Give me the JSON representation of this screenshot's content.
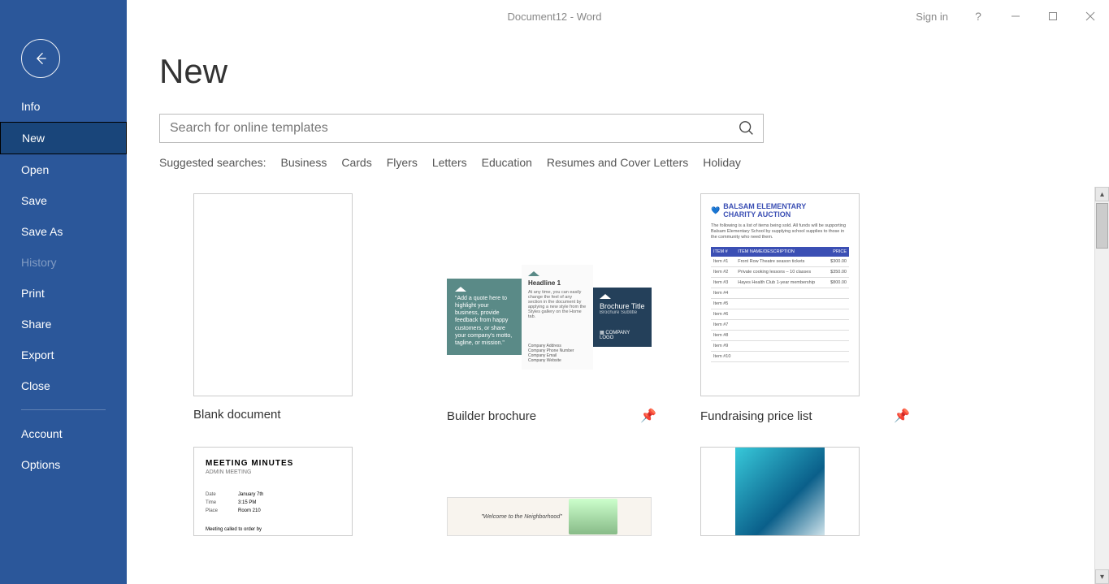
{
  "titlebar": {
    "title": "Document12  -  Word",
    "signin": "Sign in",
    "help": "?"
  },
  "sidebar": {
    "items": [
      {
        "label": "Info",
        "name": "info"
      },
      {
        "label": "New",
        "name": "new",
        "active": true
      },
      {
        "label": "Open",
        "name": "open"
      },
      {
        "label": "Save",
        "name": "save"
      },
      {
        "label": "Save As",
        "name": "save-as"
      },
      {
        "label": "History",
        "name": "history",
        "disabled": true
      },
      {
        "label": "Print",
        "name": "print"
      },
      {
        "label": "Share",
        "name": "share"
      },
      {
        "label": "Export",
        "name": "export"
      },
      {
        "label": "Close",
        "name": "close"
      }
    ],
    "footer": [
      {
        "label": "Account",
        "name": "account"
      },
      {
        "label": "Options",
        "name": "options"
      }
    ]
  },
  "page": {
    "title": "New",
    "search_placeholder": "Search for online templates",
    "suggested_label": "Suggested searches:",
    "suggested": [
      "Business",
      "Cards",
      "Flyers",
      "Letters",
      "Education",
      "Resumes and Cover Letters",
      "Holiday"
    ]
  },
  "templates": [
    {
      "label": "Blank document",
      "kind": "blank",
      "pin": false
    },
    {
      "label": "Builder brochure",
      "kind": "brochure",
      "pin": true
    },
    {
      "label": "Fundraising price list",
      "kind": "fund",
      "pin": true
    },
    {
      "label": "",
      "kind": "meeting",
      "pin": false
    },
    {
      "label": "",
      "kind": "neighbor",
      "pin": false
    },
    {
      "label": "",
      "kind": "photo",
      "pin": false
    }
  ],
  "thumb_text": {
    "brochure": {
      "quote": "\"Add a quote here to highlight your business, provide feedback from happy customers, or share your company's motto, tagline, or mission.\"",
      "headline": "Headline 1",
      "body": "At any time, you can easily change the feel of any section in the document by applying a new style from the Styles gallery on the Home tab.",
      "title": "Brochure Title",
      "subtitle": "Brochure Subtitle",
      "company": "COMPANY LOGO",
      "addr": "Company Address\nCompany Phone Number\nCompany Email\nCompany Website"
    },
    "fund": {
      "org": "BALSAM ELEMENTARY",
      "event": "CHARITY AUCTION",
      "desc": "The following is a list of items being sold. All funds will be supporting Balsam Elementary School by supplying school supplies to those in the community who need them.",
      "cols": [
        "ITEM #",
        "ITEM NAME/DESCRIPTION",
        "PRICE"
      ],
      "rows": [
        [
          "Item #1",
          "Front Row Theatre season tickets",
          "$300.00"
        ],
        [
          "Item #2",
          "Private cooking lessons – 10 classes",
          "$350.00"
        ],
        [
          "Item #3",
          "Hayes Health Club 1-year membership",
          "$800.00"
        ],
        [
          "Item #4",
          "",
          ""
        ],
        [
          "Item #5",
          "",
          ""
        ],
        [
          "Item #6",
          "",
          ""
        ],
        [
          "Item #7",
          "",
          ""
        ],
        [
          "Item #8",
          "",
          ""
        ],
        [
          "Item #9",
          "",
          ""
        ],
        [
          "Item #10",
          "",
          ""
        ]
      ]
    },
    "meeting": {
      "title": "MEETING MINUTES",
      "sub": "ADMIN MEETING",
      "rows": [
        [
          "Date",
          "January 7th"
        ],
        [
          "Time",
          "3:15 PM"
        ],
        [
          "Place",
          "Room 210"
        ]
      ],
      "called": "Meeting called to order by"
    },
    "neighbor": {
      "txt": "\"Welcome to the Neighborhood\""
    }
  }
}
